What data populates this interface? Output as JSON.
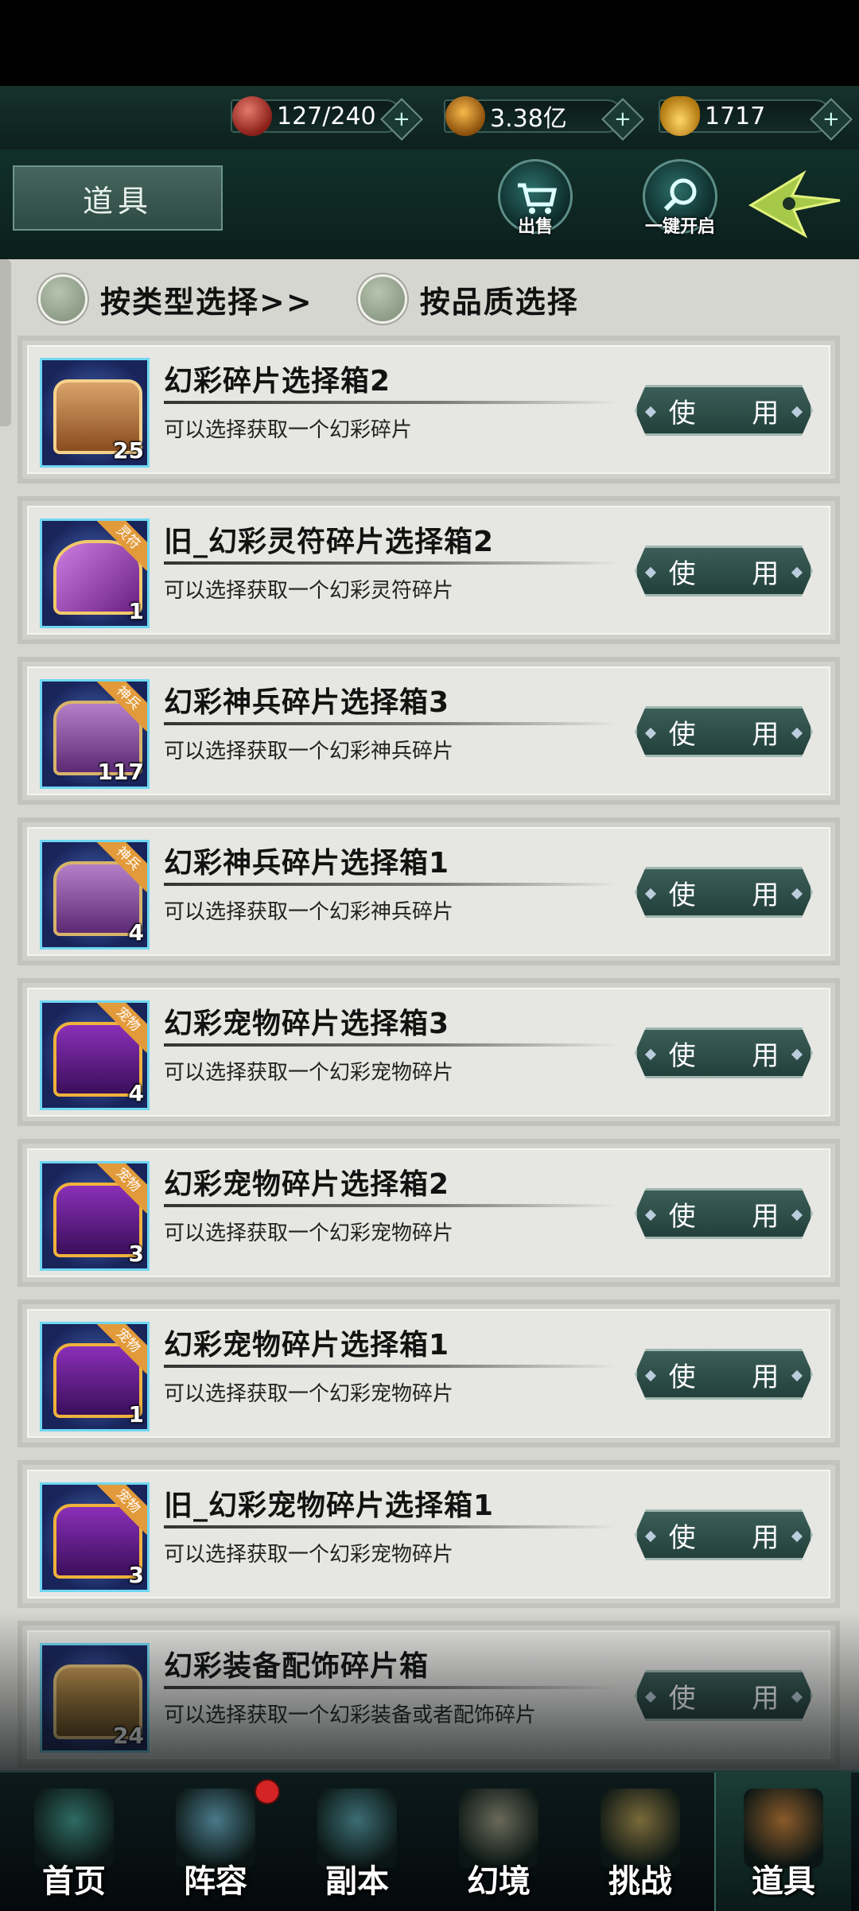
{
  "resources": [
    {
      "icon": "pearl-icon",
      "value": "127/240"
    },
    {
      "icon": "coin-icon",
      "value": "3.38亿"
    },
    {
      "icon": "ingot-icon",
      "value": "1717"
    }
  ],
  "header": {
    "title": "道具",
    "sell_label": "出售",
    "open_all_label": "一键开启"
  },
  "filters": {
    "by_type": "按类型选择>>",
    "by_quality": "按品质选择"
  },
  "items": [
    {
      "name": "幻彩碎片选择箱2",
      "desc": "可以选择获取一个幻彩碎片",
      "count": "25",
      "tag": "",
      "chest": "gold"
    },
    {
      "name": "旧_幻彩灵符碎片选择箱2",
      "desc": "可以选择获取一个幻彩灵符碎片",
      "count": "1",
      "tag": "灵符",
      "chest": "bag"
    },
    {
      "name": "幻彩神兵碎片选择箱3",
      "desc": "可以选择获取一个幻彩神兵碎片",
      "count": "117",
      "tag": "神兵",
      "chest": "purple"
    },
    {
      "name": "幻彩神兵碎片选择箱1",
      "desc": "可以选择获取一个幻彩神兵碎片",
      "count": "4",
      "tag": "神兵",
      "chest": "purple"
    },
    {
      "name": "幻彩宠物碎片选择箱3",
      "desc": "可以选择获取一个幻彩宠物碎片",
      "count": "4",
      "tag": "宠物",
      "chest": "violet"
    },
    {
      "name": "幻彩宠物碎片选择箱2",
      "desc": "可以选择获取一个幻彩宠物碎片",
      "count": "3",
      "tag": "宠物",
      "chest": "violet"
    },
    {
      "name": "幻彩宠物碎片选择箱1",
      "desc": "可以选择获取一个幻彩宠物碎片",
      "count": "1",
      "tag": "宠物",
      "chest": "violet"
    },
    {
      "name": "旧_幻彩宠物碎片选择箱1",
      "desc": "可以选择获取一个幻彩宠物碎片",
      "count": "3",
      "tag": "宠物",
      "chest": "violet"
    },
    {
      "name": "幻彩装备配饰碎片箱",
      "desc": "可以选择获取一个幻彩装备或者配饰碎片",
      "count": "24",
      "tag": "",
      "chest": "brown"
    }
  ],
  "use_label": "使 用",
  "nav": [
    {
      "label": "首页",
      "icon": "palace-icon"
    },
    {
      "label": "阵容",
      "icon": "cards-icon"
    },
    {
      "label": "副本",
      "icon": "sword-icon"
    },
    {
      "label": "幻境",
      "icon": "crossed-swords-icon"
    },
    {
      "label": "挑战",
      "icon": "scroll-icon"
    },
    {
      "label": "道具",
      "icon": "bag-icon"
    }
  ],
  "colors": {
    "accent": "#2d4a43",
    "panel": "#e6e6e2",
    "count_badge_tag": "#e29a3a",
    "notification": "#d42424"
  }
}
